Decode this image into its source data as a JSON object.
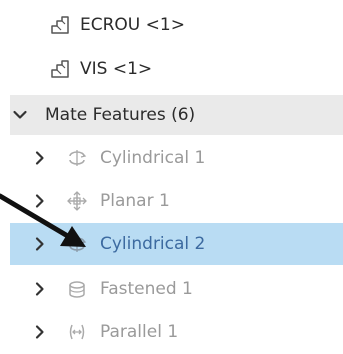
{
  "parts": [
    {
      "label": "ECROU <1>"
    },
    {
      "label": "VIS <1>"
    }
  ],
  "mate_section": {
    "label": "Mate Features (6)"
  },
  "mates": [
    {
      "label": "Cylindrical 1",
      "icon": "cylindrical-mate-icon",
      "selected": false
    },
    {
      "label": "Planar 1",
      "icon": "planar-mate-icon",
      "selected": false
    },
    {
      "label": "Cylindrical 2",
      "icon": "cylindrical-mate-icon",
      "selected": true
    },
    {
      "label": "Fastened 1",
      "icon": "fastened-mate-icon",
      "selected": false
    },
    {
      "label": "Parallel 1",
      "icon": "parallel-mate-icon",
      "selected": false
    }
  ],
  "colors": {
    "selected_background": "#b9dcf3",
    "section_background": "#eaeaea",
    "selected_text": "#3c6aa0",
    "muted_text": "#9a9a9a",
    "arrow": "#111111"
  }
}
